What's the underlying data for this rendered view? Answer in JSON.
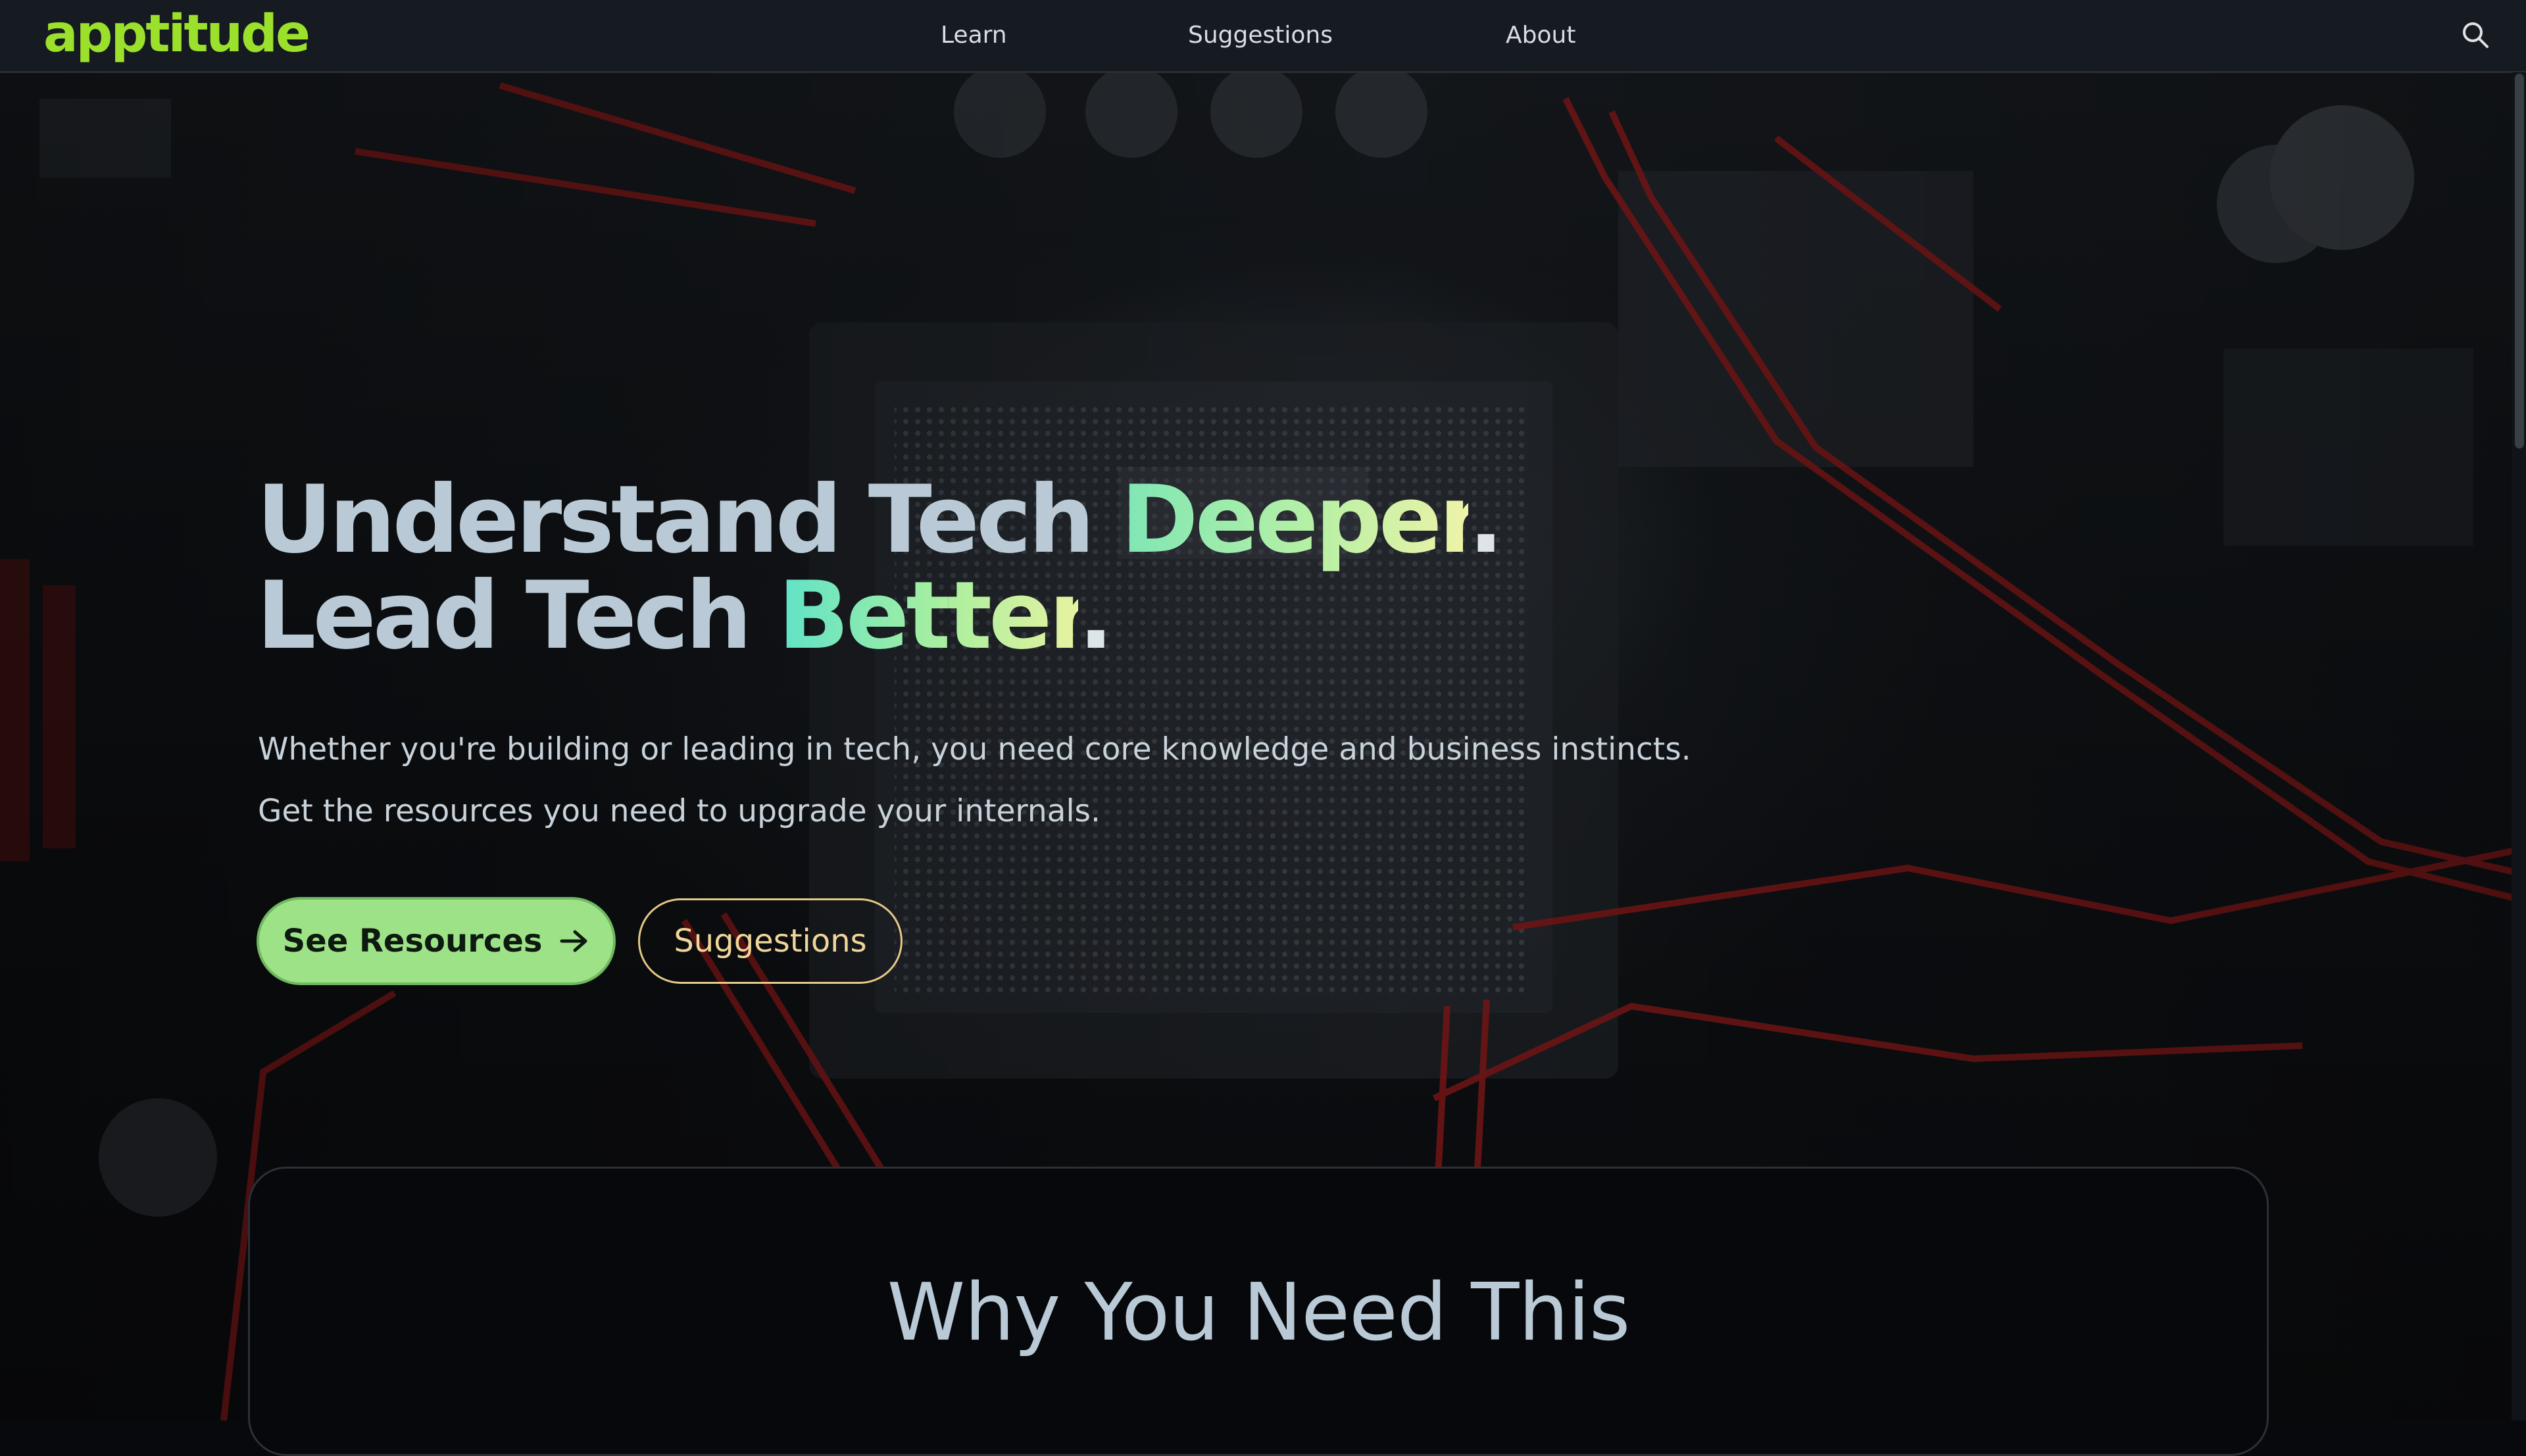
{
  "brand": {
    "logo_text": "apptitude",
    "logo_color": "#9be02b"
  },
  "nav": {
    "items": [
      {
        "label": "Learn"
      },
      {
        "label": "Suggestions"
      },
      {
        "label": "About"
      }
    ],
    "search_icon": "search-icon"
  },
  "hero": {
    "headline_line1_plain": "Understand Tech ",
    "headline_line1_accent": "Deeper",
    "headline_line1_end": ".",
    "headline_line2_plain": "Lead Tech ",
    "headline_line2_accent": "Better",
    "headline_line2_end": ".",
    "subtext_line1": "Whether you're building or leading in tech, you need core knowledge and business instincts.",
    "subtext_line2": "Get the resources you need to upgrade your internals.",
    "primary_button": {
      "label": "See Resources",
      "icon": "arrow-right-icon",
      "color": "#9ee288"
    },
    "secondary_button": {
      "label": "Suggestions",
      "color": "#e6c986"
    }
  },
  "section": {
    "title": "Why You Need This"
  },
  "colors": {
    "background": "#07090c",
    "topbar": "#161a21",
    "headline": "#b9cad6",
    "accent_gradient_start": "#7fe6b5",
    "accent_gradient_end": "#eef3a8"
  }
}
